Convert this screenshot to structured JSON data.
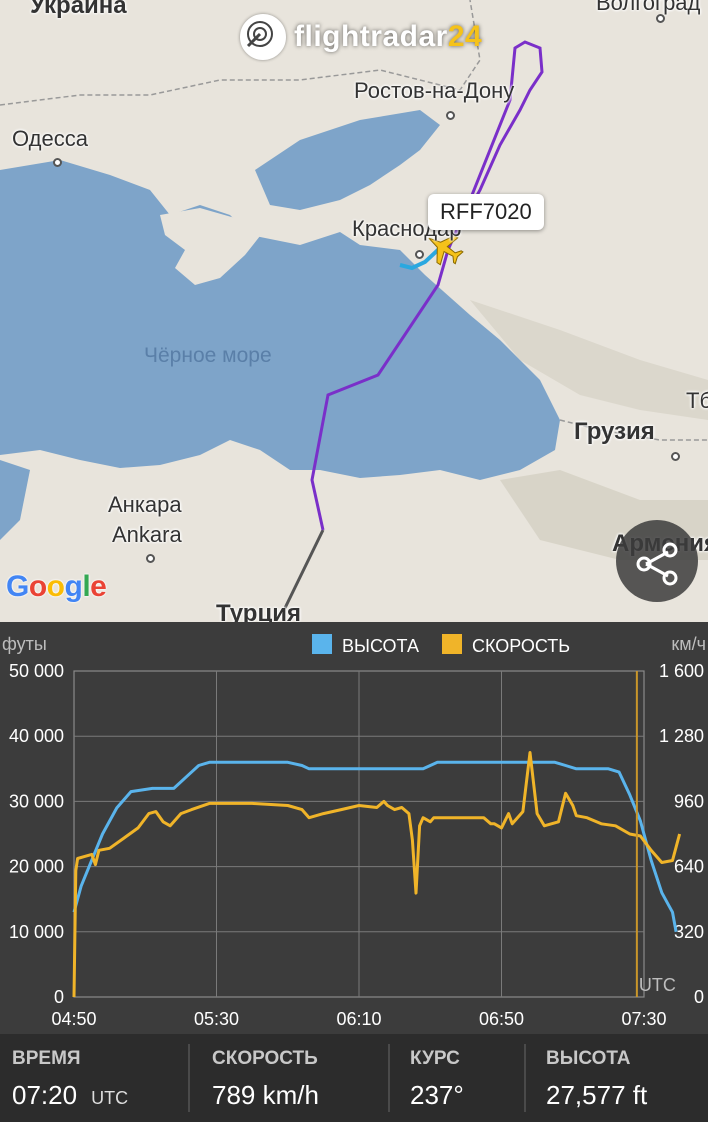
{
  "map": {
    "brand": {
      "text_main": "flightradar",
      "text_accent": "24"
    },
    "callsign": "RFF7020",
    "sea_label": "Чёрное море",
    "labels": {
      "ukraine": "Украина",
      "volgograd": "Волгоград",
      "rostov": "Ростов-на-Дону",
      "odessa": "Одесса",
      "krasnodar": "Краснодар",
      "georgia": "Грузия",
      "ankara_ru": "Анкара",
      "ankara_en": "Ankara",
      "armenia": "Армения",
      "turkey": "Турция",
      "tb": "Тб"
    },
    "google_logo": "Google",
    "share_icon": "share-icon",
    "plane_icon": "airplane-icon",
    "colors": {
      "sea": "#7ea4c9",
      "land": "#e8e4dc",
      "track": "#7a2fc9",
      "track_old": "#555555",
      "track_recent": "#2aa8e0",
      "plane": "#f5c21a"
    }
  },
  "chart_data": {
    "type": "line",
    "legend": [
      {
        "name": "ВЫСОТА",
        "color": "#5ab4ec"
      },
      {
        "name": "СКОРОСТЬ",
        "color": "#f0b429"
      }
    ],
    "left_unit": "футы",
    "right_unit": "км/ч",
    "xlabels": [
      "04:50",
      "05:30",
      "06:10",
      "06:50",
      "07:30"
    ],
    "ylim_left": [
      0,
      50000
    ],
    "yticks_left": [
      "0",
      "10 000",
      "20 000",
      "30 000",
      "40 000",
      "50 000"
    ],
    "ylim_right": [
      0,
      1600
    ],
    "yticks_right": [
      "0",
      "320",
      "640",
      "960",
      "1 280",
      "1 600"
    ],
    "cursor_label": "UTC",
    "cursor_time_min": 158,
    "series": [
      {
        "name": "ВЫСОТА",
        "points": [
          [
            0,
            13000
          ],
          [
            2,
            17000
          ],
          [
            5,
            21000
          ],
          [
            8,
            25000
          ],
          [
            12,
            29000
          ],
          [
            16,
            31500
          ],
          [
            22,
            32000
          ],
          [
            28,
            32000
          ],
          [
            32,
            34000
          ],
          [
            35,
            35500
          ],
          [
            38,
            36000
          ],
          [
            50,
            36000
          ],
          [
            60,
            36000
          ],
          [
            64,
            35500
          ],
          [
            66,
            35000
          ],
          [
            80,
            35000
          ],
          [
            90,
            35000
          ],
          [
            98,
            35000
          ],
          [
            100,
            35500
          ],
          [
            102,
            36000
          ],
          [
            120,
            36000
          ],
          [
            128,
            36000
          ],
          [
            135,
            36000
          ],
          [
            138,
            35500
          ],
          [
            141,
            35000
          ],
          [
            150,
            35000
          ],
          [
            153,
            34500
          ],
          [
            156,
            31000
          ],
          [
            159,
            27000
          ],
          [
            162,
            21000
          ],
          [
            165,
            16000
          ],
          [
            167,
            14000
          ],
          [
            168,
            13000
          ],
          [
            169,
            10000
          ]
        ]
      },
      {
        "name": "СКОРОСТЬ",
        "points": [
          [
            0,
            0
          ],
          [
            0.5,
            620
          ],
          [
            1,
            680
          ],
          [
            3,
            690
          ],
          [
            5,
            700
          ],
          [
            6,
            650
          ],
          [
            7,
            720
          ],
          [
            10,
            730
          ],
          [
            14,
            780
          ],
          [
            18,
            830
          ],
          [
            21,
            900
          ],
          [
            23,
            910
          ],
          [
            25,
            860
          ],
          [
            27,
            840
          ],
          [
            30,
            900
          ],
          [
            33,
            920
          ],
          [
            38,
            950
          ],
          [
            50,
            950
          ],
          [
            60,
            940
          ],
          [
            64,
            920
          ],
          [
            66,
            880
          ],
          [
            70,
            900
          ],
          [
            75,
            920
          ],
          [
            80,
            940
          ],
          [
            85,
            930
          ],
          [
            87,
            960
          ],
          [
            88,
            940
          ],
          [
            90,
            920
          ],
          [
            92,
            930
          ],
          [
            94,
            900
          ],
          [
            95,
            770
          ],
          [
            96,
            510
          ],
          [
            97,
            840
          ],
          [
            98,
            880
          ],
          [
            100,
            860
          ],
          [
            101,
            880
          ],
          [
            103,
            880
          ],
          [
            115,
            880
          ],
          [
            117,
            850
          ],
          [
            118,
            850
          ],
          [
            120,
            830
          ],
          [
            122,
            900
          ],
          [
            123,
            850
          ],
          [
            126,
            910
          ],
          [
            128,
            1200
          ],
          [
            130,
            900
          ],
          [
            132,
            840
          ],
          [
            134,
            850
          ],
          [
            136,
            860
          ],
          [
            138,
            1000
          ],
          [
            140,
            940
          ],
          [
            141,
            890
          ],
          [
            144,
            880
          ],
          [
            148,
            850
          ],
          [
            152,
            840
          ],
          [
            156,
            800
          ],
          [
            159,
            790
          ],
          [
            162,
            720
          ],
          [
            165,
            660
          ],
          [
            168,
            670
          ],
          [
            170,
            800
          ]
        ]
      }
    ]
  },
  "stats": {
    "time": {
      "label": "ВРЕМЯ",
      "value": "07:20",
      "unit": "UTC"
    },
    "speed": {
      "label": "СКОРОСТЬ",
      "value": "789 km/h"
    },
    "course": {
      "label": "КУРС",
      "value": "237°"
    },
    "altitude": {
      "label": "ВЫСОТА",
      "value": "27,577 ft"
    }
  }
}
